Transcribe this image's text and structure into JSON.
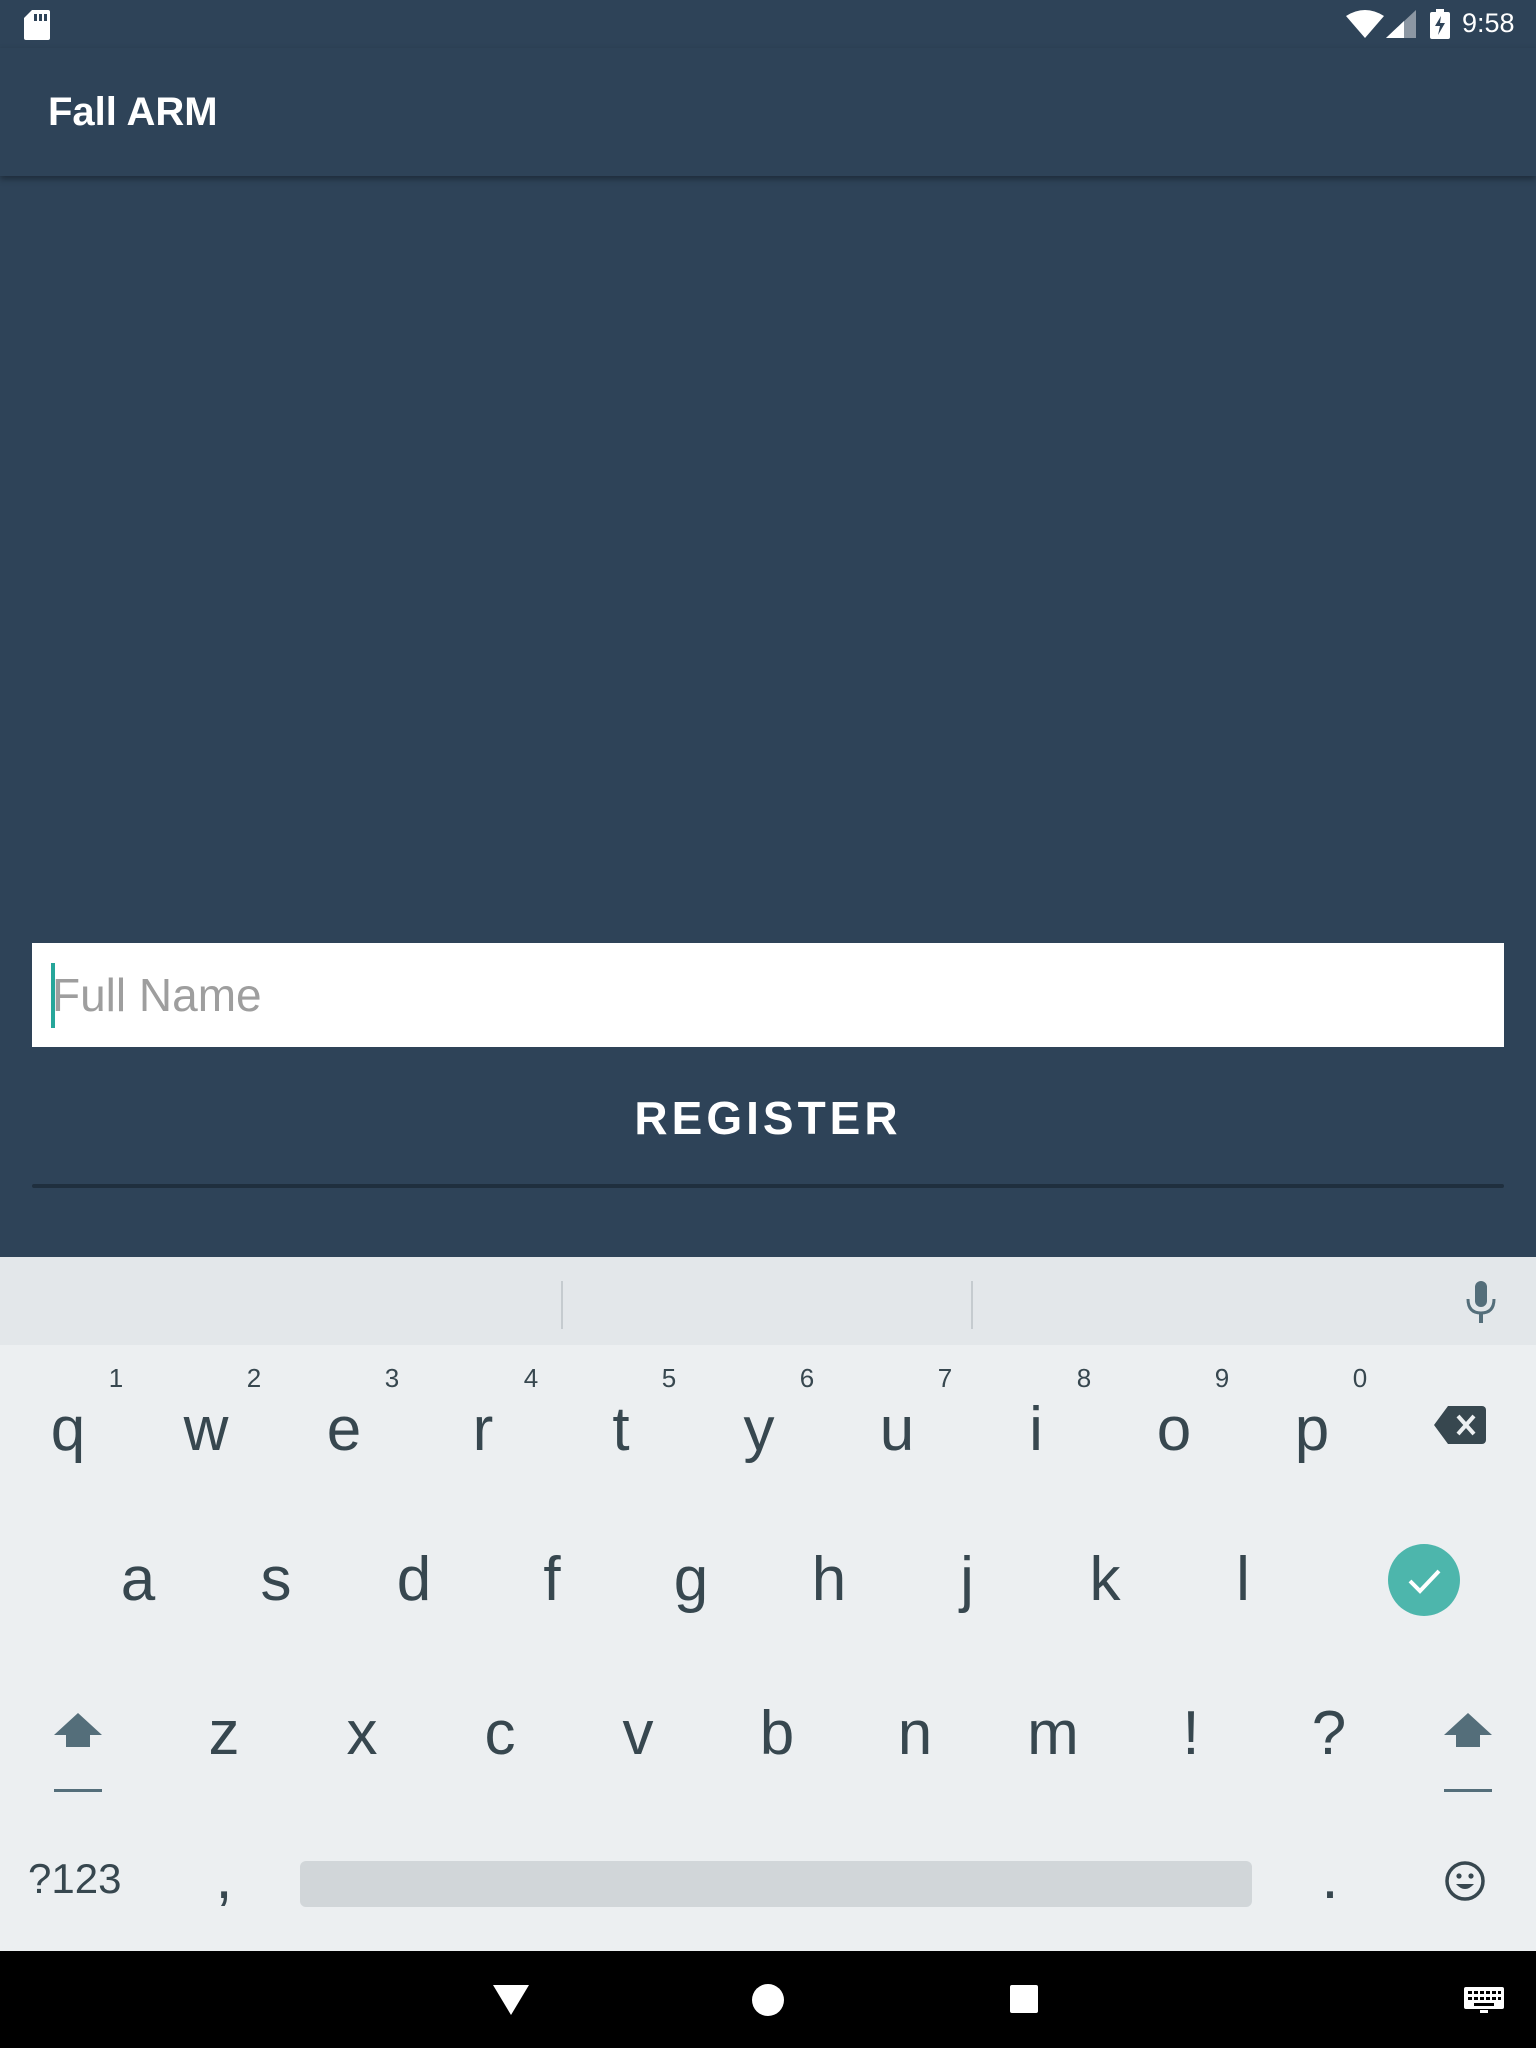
{
  "status_bar": {
    "time": "9:58",
    "icons": [
      "sd-card-icon",
      "wifi-icon",
      "cell-signal-icon",
      "battery-charging-icon"
    ]
  },
  "app_bar": {
    "title": "Fall ARM"
  },
  "form": {
    "name_placeholder": "Full Name",
    "name_value": "",
    "register_label": "REGISTER",
    "accent_color": "#26a69a",
    "background_color": "#2e4358"
  },
  "keyboard": {
    "row1": [
      {
        "key": "q",
        "hint": "1"
      },
      {
        "key": "w",
        "hint": "2"
      },
      {
        "key": "e",
        "hint": "3"
      },
      {
        "key": "r",
        "hint": "4"
      },
      {
        "key": "t",
        "hint": "5"
      },
      {
        "key": "y",
        "hint": "6"
      },
      {
        "key": "u",
        "hint": "7"
      },
      {
        "key": "i",
        "hint": "8"
      },
      {
        "key": "o",
        "hint": "9"
      },
      {
        "key": "p",
        "hint": "0"
      }
    ],
    "row2": [
      "a",
      "s",
      "d",
      "f",
      "g",
      "h",
      "j",
      "k",
      "l"
    ],
    "row3": [
      "z",
      "x",
      "c",
      "v",
      "b",
      "n",
      "m",
      "!",
      "?"
    ],
    "mode_label": "?123",
    "comma": ",",
    "period": ".",
    "icons": [
      "mic-icon",
      "backspace-icon",
      "done-check-icon",
      "shift-icon",
      "emoji-icon"
    ]
  },
  "nav_bar": {
    "icons": [
      "back-icon",
      "home-icon",
      "recents-icon",
      "keyboard-switch-icon"
    ]
  }
}
